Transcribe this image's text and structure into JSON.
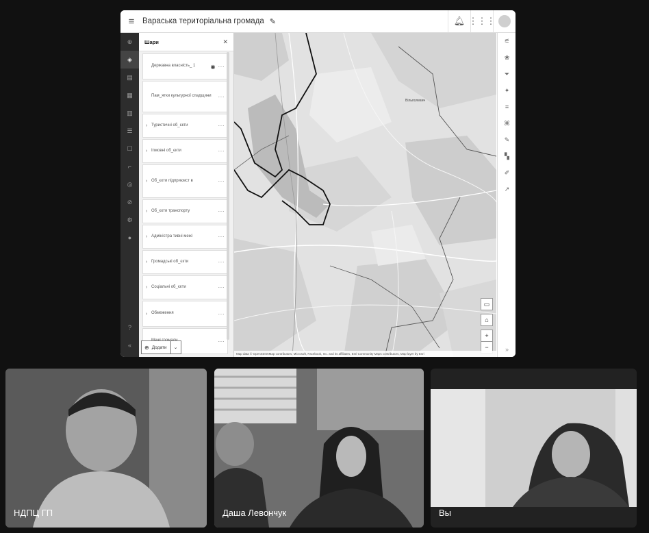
{
  "app": {
    "title": "Вараська територіальна громада",
    "edit_icon": "pencil-icon",
    "notifications_icon": "bell-icon",
    "apps_icon": "grid-icon",
    "avatar_icon": "avatar-icon",
    "menu_icon": "hamburger-icon"
  },
  "layers_panel": {
    "title": "Шари",
    "close_icon": "close-icon",
    "layers": [
      {
        "label": "Державна власність_ 1",
        "has_eye": true
      },
      {
        "label": "Пам_ятки культурної спадщини",
        "has_eye": false
      },
      {
        "label": "Туристичні об_єкти",
        "has_eye": false
      },
      {
        "label": "Іпмовні об_єкти",
        "has_eye": false
      },
      {
        "label": "Об_єкти підприємст в",
        "has_eye": false
      },
      {
        "label": "Об_єкти транспорту",
        "has_eye": false
      },
      {
        "label": "Адміністра тивні межі",
        "has_eye": false
      },
      {
        "label": "Громадські об_єкти",
        "has_eye": false
      },
      {
        "label": "Соціальні об_єкти",
        "has_eye": false
      },
      {
        "label": "Обмеження",
        "has_eye": false
      },
      {
        "label": "Межі громади",
        "has_eye": false
      }
    ],
    "add_button": "Додати"
  },
  "map": {
    "town_label": "Вільполевич",
    "attribution": "Map data © OpenStreetMap contributors, Microsoft, Facebook, Inc. and its affiliates, Esri Community Maps contributors, Map layer by Esri"
  },
  "participants": [
    {
      "name": "НДПЦ ГП"
    },
    {
      "name": "Даша Левончук"
    },
    {
      "name": "Вы"
    }
  ]
}
